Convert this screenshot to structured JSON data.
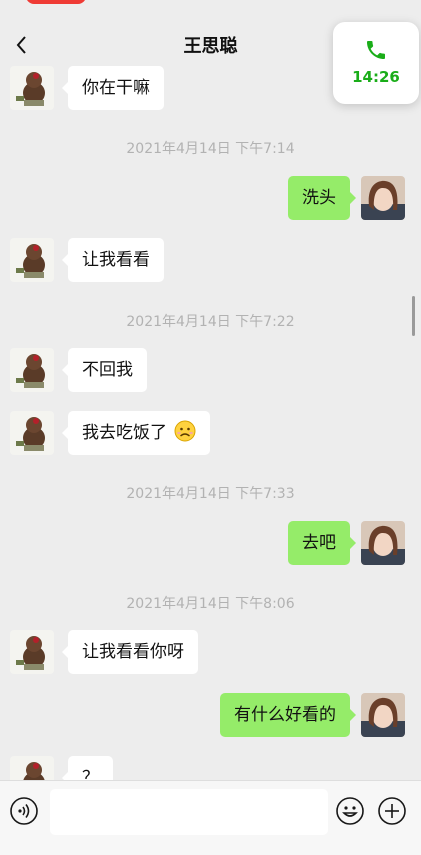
{
  "header": {
    "title": "王思聪"
  },
  "call_widget": {
    "time": "14:26",
    "accent": "#1aad19"
  },
  "colors": {
    "sent_bubble": "#95ec69",
    "received_bubble": "#ffffff",
    "background": "#ededed"
  },
  "messages": [
    {
      "type": "received",
      "text": "你在干嘛"
    },
    {
      "type": "timestamp",
      "text": "2021年4月14日 下午7:14"
    },
    {
      "type": "sent",
      "text": "洗头"
    },
    {
      "type": "received",
      "text": "让我看看"
    },
    {
      "type": "timestamp",
      "text": "2021年4月14日 下午7:22"
    },
    {
      "type": "received",
      "text": "不回我"
    },
    {
      "type": "received",
      "text": "我去吃饭了",
      "emoji": "frowning-face-icon"
    },
    {
      "type": "timestamp",
      "text": "2021年4月14日 下午7:33"
    },
    {
      "type": "sent",
      "text": "去吧"
    },
    {
      "type": "timestamp",
      "text": "2021年4月14日 下午8:06"
    },
    {
      "type": "received",
      "text": "让我看看你呀"
    },
    {
      "type": "sent",
      "text": "有什么好看的"
    },
    {
      "type": "received",
      "text": "？"
    }
  ],
  "input": {
    "value": "",
    "placeholder": ""
  },
  "icons": [
    "back-chevron-icon",
    "phone-icon",
    "voice-icon",
    "emoji-icon",
    "plus-icon"
  ]
}
